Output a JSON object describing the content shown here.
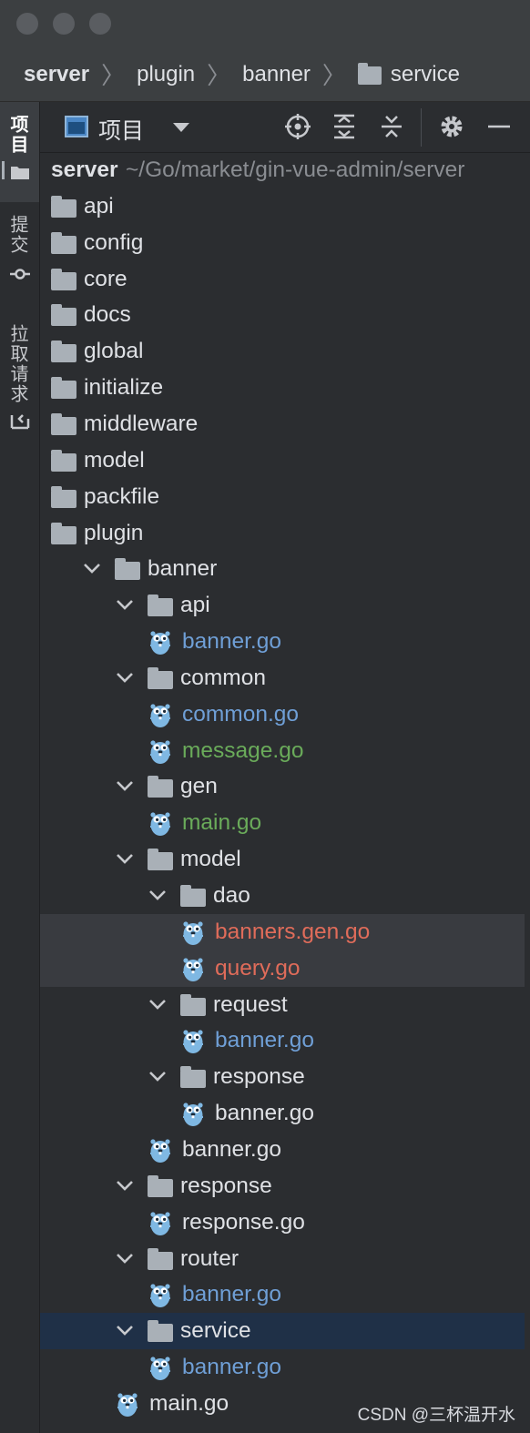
{
  "breadcrumb": {
    "items": [
      "server",
      "plugin",
      "banner",
      "service"
    ]
  },
  "sidebar": {
    "tabs": [
      {
        "label": "项目",
        "icon": "folder-icon"
      },
      {
        "label": "提交",
        "icon": "commit-icon"
      },
      {
        "label": "拉取请求",
        "icon": "pull-request-icon"
      }
    ]
  },
  "toolbar": {
    "view_label": "项目",
    "icons": [
      "locate-icon",
      "expand-all-icon",
      "collapse-all-icon",
      "settings-icon",
      "minimize-icon"
    ]
  },
  "tree": {
    "root": {
      "name": "server",
      "path": "~/Go/market/gin-vue-admin/server"
    },
    "rows": [
      {
        "label": "api",
        "type": "folder",
        "depth": 0,
        "color": "default"
      },
      {
        "label": "config",
        "type": "folder",
        "depth": 0,
        "color": "default"
      },
      {
        "label": "core",
        "type": "folder",
        "depth": 0,
        "color": "default"
      },
      {
        "label": "docs",
        "type": "folder",
        "depth": 0,
        "color": "default"
      },
      {
        "label": "global",
        "type": "folder",
        "depth": 0,
        "color": "default"
      },
      {
        "label": "initialize",
        "type": "folder",
        "depth": 0,
        "color": "default"
      },
      {
        "label": "middleware",
        "type": "folder",
        "depth": 0,
        "color": "default"
      },
      {
        "label": "model",
        "type": "folder",
        "depth": 0,
        "color": "default"
      },
      {
        "label": "packfile",
        "type": "folder",
        "depth": 0,
        "color": "default"
      },
      {
        "label": "plugin",
        "type": "folder",
        "depth": 0,
        "color": "default"
      },
      {
        "label": "banner",
        "type": "folder",
        "depth": 1,
        "expanded": true,
        "color": "default"
      },
      {
        "label": "api",
        "type": "folder",
        "depth": 2,
        "expanded": true,
        "color": "default"
      },
      {
        "label": "banner.go",
        "type": "file",
        "depth": 3,
        "color": "blue"
      },
      {
        "label": "common",
        "type": "folder",
        "depth": 2,
        "expanded": true,
        "color": "default"
      },
      {
        "label": "common.go",
        "type": "file",
        "depth": 3,
        "color": "blue"
      },
      {
        "label": "message.go",
        "type": "file",
        "depth": 3,
        "color": "green"
      },
      {
        "label": "gen",
        "type": "folder",
        "depth": 2,
        "expanded": true,
        "color": "default"
      },
      {
        "label": "main.go",
        "type": "file",
        "depth": 3,
        "color": "green"
      },
      {
        "label": "model",
        "type": "folder",
        "depth": 2,
        "expanded": true,
        "color": "default"
      },
      {
        "label": "dao",
        "type": "folder",
        "depth": 3,
        "expanded": true,
        "color": "default"
      },
      {
        "label": "banners.gen.go",
        "type": "file",
        "depth": 4,
        "color": "red",
        "highlighted": true
      },
      {
        "label": "query.go",
        "type": "file",
        "depth": 4,
        "color": "red",
        "highlighted": true
      },
      {
        "label": "request",
        "type": "folder",
        "depth": 3,
        "expanded": true,
        "color": "default"
      },
      {
        "label": "banner.go",
        "type": "file",
        "depth": 4,
        "color": "blue"
      },
      {
        "label": "response",
        "type": "folder",
        "depth": 3,
        "expanded": true,
        "color": "default"
      },
      {
        "label": "banner.go",
        "type": "file",
        "depth": 4,
        "color": "default"
      },
      {
        "label": "banner.go",
        "type": "file",
        "depth": 3,
        "color": "default"
      },
      {
        "label": "response",
        "type": "folder",
        "depth": 2,
        "expanded": true,
        "color": "default"
      },
      {
        "label": "response.go",
        "type": "file",
        "depth": 3,
        "color": "default"
      },
      {
        "label": "router",
        "type": "folder",
        "depth": 2,
        "expanded": true,
        "color": "default"
      },
      {
        "label": "banner.go",
        "type": "file",
        "depth": 3,
        "color": "blue"
      },
      {
        "label": "service",
        "type": "folder",
        "depth": 2,
        "expanded": true,
        "color": "default",
        "selected": true
      },
      {
        "label": "banner.go",
        "type": "file",
        "depth": 3,
        "color": "blue"
      },
      {
        "label": "main.go",
        "type": "file",
        "depth": 2,
        "color": "default"
      }
    ]
  },
  "watermark": "CSDN @三杯温开水",
  "colors": {
    "background": "#2b2d30",
    "selection": "#1f3047",
    "highlight": "#393b40",
    "vcs_modified": "#6f9fd6",
    "vcs_added": "#6aab5a",
    "vcs_unversioned": "#e06c5a"
  }
}
